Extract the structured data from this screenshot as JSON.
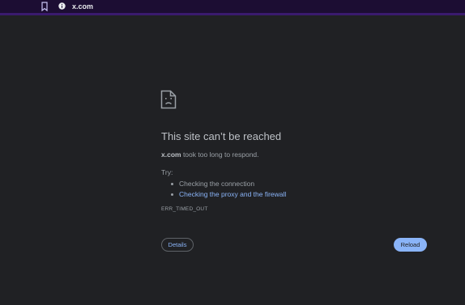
{
  "address_bar": {
    "url": "x.com"
  },
  "error": {
    "title": "This site can’t be reached",
    "host": "x.com",
    "message_suffix": " took too long to respond.",
    "try_label": "Try:",
    "suggestions": [
      {
        "text": "Checking the connection",
        "is_link": false
      },
      {
        "text": "Checking the proxy and the firewall",
        "is_link": true
      }
    ],
    "code": "ERR_TIMED_OUT"
  },
  "buttons": {
    "details_label": "Details",
    "reload_label": "Reload"
  },
  "colors": {
    "background": "#202124",
    "topbar": "#1c0d33",
    "topbar_accent": "#3a1a6e",
    "link": "#8ab4f8",
    "primary_button": "#8ab4f8"
  },
  "icons": {
    "bookmark": "bookmark-icon",
    "info": "info-icon",
    "error_page": "sad-document-icon"
  }
}
